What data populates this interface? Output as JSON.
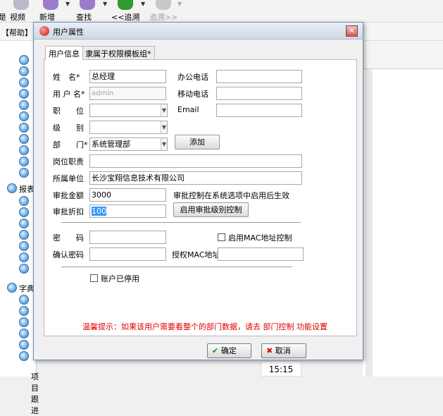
{
  "toolbar": {
    "view_label": "视频",
    "new_label": "新增",
    "find_label": "查找",
    "trace_back_label": "<<追溯",
    "trace_forward_label": "追溯>>"
  },
  "menu": {
    "help_label": "【帮助】"
  },
  "tree": {
    "report_label": "报表",
    "dict_label": "字典",
    "project_label": "项目跟进"
  },
  "status": {
    "time": "15:15"
  },
  "dialog": {
    "title": "用户属性",
    "close_glyph": "✕",
    "tabs": [
      {
        "label": "用户信息"
      },
      {
        "label": "隶属于权限模板组*"
      }
    ],
    "fields": {
      "name_label": "姓　名*",
      "name_value": "总经理",
      "office_phone_label": "办公电话",
      "office_phone_value": "",
      "username_label": "用 户 名*",
      "username_value": "admin",
      "mobile_label": "移动电话",
      "mobile_value": "",
      "position_label": "职　　位",
      "position_value": "",
      "email_label": "Email",
      "email_value": "",
      "level_label": "级　　别",
      "level_value": "",
      "dept_label": "部　　门*",
      "dept_value": "系统管理部",
      "add_button": "添加",
      "duty_label": "岗位职责",
      "duty_value": "",
      "company_label": "所属单位",
      "company_value": "长沙宝翔信息技术有限公司",
      "approve_amount_label": "审批金额",
      "approve_amount_value": "3000",
      "approve_note": "审批控制在系统选项中启用后生效",
      "approve_discount_label": "审批折扣",
      "approve_discount_value": "100",
      "approve_level_button": "启用审批级别控制",
      "password_label": "密　　码",
      "password_value": "",
      "mac_checkbox_label": "启用MAC地址控制",
      "mac_checked": false,
      "confirm_password_label": "确认密码",
      "confirm_password_value": "",
      "mac_addr_label": "授权MAC地址",
      "mac_addr_value": "",
      "disabled_label": "账户已停用",
      "disabled_checked": false
    },
    "hint": "温馨提示：如果该用户需要看整个的部门数据，请去 部门控制 功能设置",
    "ok_label": "确定",
    "cancel_label": "取消"
  }
}
